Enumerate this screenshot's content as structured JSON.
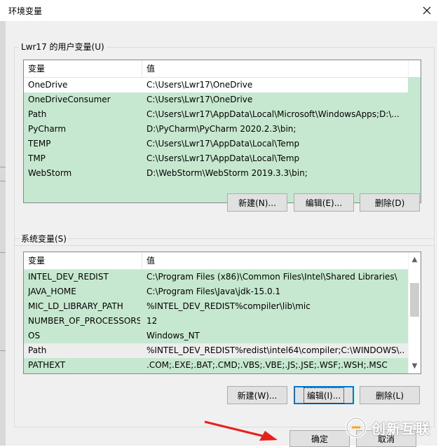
{
  "window": {
    "title": "环境变量",
    "close_glyph": "✕"
  },
  "user_vars": {
    "group_label": "Lwr17 的用户变量(U)",
    "columns": [
      "变量",
      "值"
    ],
    "rows": [
      {
        "name": "OneDrive",
        "value": "C:\\Users\\Lwr17\\OneDrive"
      },
      {
        "name": "OneDriveConsumer",
        "value": "C:\\Users\\Lwr17\\OneDrive"
      },
      {
        "name": "Path",
        "value": "C:\\Users\\Lwr17\\AppData\\Local\\Microsoft\\WindowsApps;D:\\..."
      },
      {
        "name": "PyCharm",
        "value": "D:\\PyCharm\\PyCharm 2020.2.3\\bin;"
      },
      {
        "name": "TEMP",
        "value": "C:\\Users\\Lwr17\\AppData\\Local\\Temp"
      },
      {
        "name": "TMP",
        "value": "C:\\Users\\Lwr17\\AppData\\Local\\Temp"
      },
      {
        "name": "WebStorm",
        "value": "D:\\WebStorm\\WebStorm 2019.3.3\\bin;"
      }
    ],
    "buttons": {
      "new": "新建(N)...",
      "edit": "编辑(E)...",
      "delete": "删除(D)"
    }
  },
  "system_vars": {
    "group_label": "系统变量(S)",
    "columns": [
      "变量",
      "值"
    ],
    "rows": [
      {
        "name": "INTEL_DEV_REDIST",
        "value": "C:\\Program Files (x86)\\Common Files\\Intel\\Shared Libraries\\"
      },
      {
        "name": "JAVA_HOME",
        "value": "C:\\Program Files\\Java\\jdk-15.0.1"
      },
      {
        "name": "MIC_LD_LIBRARY_PATH",
        "value": "%INTEL_DEV_REDIST%compiler\\lib\\mic"
      },
      {
        "name": "NUMBER_OF_PROCESSORS",
        "value": "12"
      },
      {
        "name": "OS",
        "value": "Windows_NT"
      },
      {
        "name": "Path",
        "value": "%INTEL_DEV_REDIST%redist\\intel64\\compiler;C:\\WINDOWS\\..."
      },
      {
        "name": "PATHEXT",
        "value": ".COM;.EXE;.BAT;.CMD;.VBS;.VBE;.JS;.JSE;.WSF;.WSH;.MSC"
      }
    ],
    "buttons": {
      "new": "新建(W)...",
      "edit": "编辑(I)...",
      "delete": "删除(L)"
    }
  },
  "footer": {
    "ok": "确定",
    "cancel": "取消"
  },
  "watermark": {
    "text": "创新互联"
  },
  "colors": {
    "list_bg": "#c7e8d0",
    "accent": "#0078d7",
    "annotation_arrow": "#e8201b"
  }
}
